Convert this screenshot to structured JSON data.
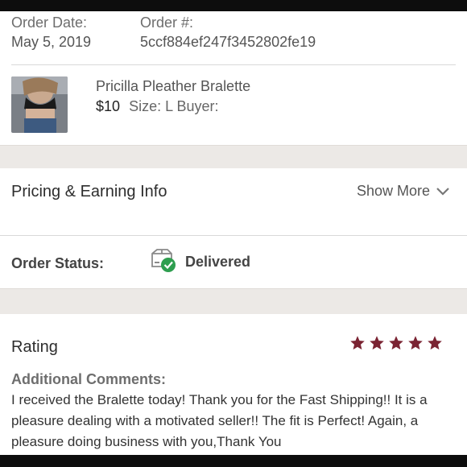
{
  "order": {
    "date_label": "Order Date:",
    "date_value": "May 5, 2019",
    "number_label": "Order #:",
    "number_value": "5ccf884ef247f3452802fe19"
  },
  "item": {
    "title": "Pricilla Pleather Bralette",
    "price": "$10",
    "size_label": "Size: L",
    "buyer_label": "Buyer:"
  },
  "pricing": {
    "title": "Pricing & Earning Info",
    "show_more": "Show More"
  },
  "status": {
    "label": "Order Status:",
    "value": "Delivered",
    "icon": "delivered-box-icon",
    "check_color": "#2e9e4f"
  },
  "rating": {
    "title": "Rating",
    "stars": 5,
    "star_color": "#7a2332",
    "comments_label": "Additional Comments:",
    "comments": "I received the Bralette today! Thank you for the Fast Shipping!! It is a pleasure dealing with a motivated seller!! The fit is Perfect! Again, a pleasure doing business with you,Thank You"
  }
}
